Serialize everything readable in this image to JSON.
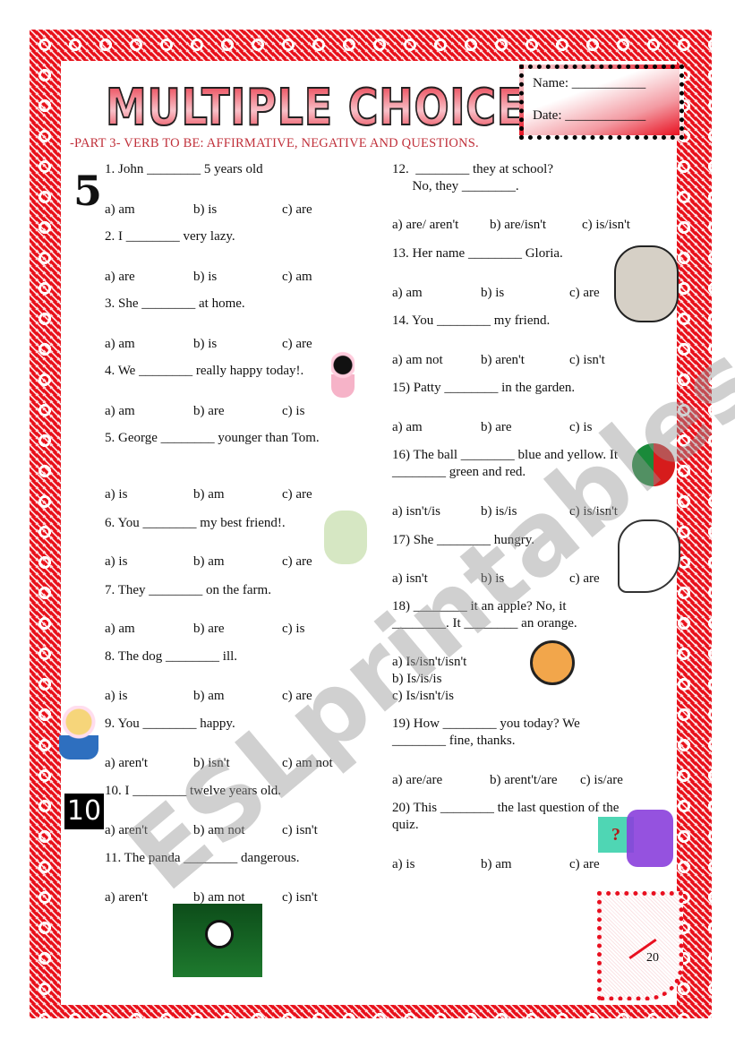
{
  "header": {
    "title": "MULTIPLE CHOICE",
    "subtitle": "-PART 3- VERB TO BE: AFFIRMATIVE, NEGATIVE AND QUESTIONS.",
    "name_label": "Name: ___________",
    "date_label": "Date: ____________"
  },
  "questions": [
    {
      "text": "1. John ________ 5 years old",
      "a": "a) am",
      "b": "b) is",
      "c": "c) are"
    },
    {
      "text": "2. I ________ very lazy.",
      "a": "a) are",
      "b": "b) is",
      "c": "c) am"
    },
    {
      "text": "3. She ________ at home.",
      "a": "a) am",
      "b": "b) is",
      "c": "c) are"
    },
    {
      "text": "4. We ________  really happy today!.",
      "a": "a) am",
      "b": "b) are",
      "c": "c) is"
    },
    {
      "text": "5. George ________ younger than Tom.",
      "a": "a) is",
      "b": "b) am",
      "c": "c) are"
    },
    {
      "text": "6. You ________ my best friend!.",
      "a": "a) is",
      "b": "b) am",
      "c": "c) are"
    },
    {
      "text": "7. They ________ on the farm.",
      "a": "a) am",
      "b": "b) are",
      "c": "c) is"
    },
    {
      "text": "8. The dog ________ ill.",
      "a": "a) is",
      "b": "b) am",
      "c": "c) are"
    },
    {
      "text": "9. You ________ happy.",
      "a": "a) aren't",
      "b": "b) isn't",
      "c": "c) am not"
    },
    {
      "text": "10. I ________  twelve years old.",
      "a": "a) aren't",
      "b": "b) am not",
      "c": "c) isn't"
    },
    {
      "text": "11. The panda ________ dangerous.",
      "a": "a) aren't",
      "b": "b) am not",
      "c": "c) isn't"
    },
    {
      "text": "12.  ________ they at school?\n      No, they ________.",
      "a": "a) are/ aren't",
      "b": "b) are/isn't",
      "c": "c) is/isn't"
    },
    {
      "text": "13. Her name  ________ Gloria.",
      "a": "a) am",
      "b": "b) is",
      "c": "c) are"
    },
    {
      "text": "14. You ________ my friend.",
      "a": "a) am not",
      "b": "b) aren't",
      "c": "c) isn't"
    },
    {
      "text": "15) Patty  ________  in the garden.",
      "a": "a) am",
      "b": "b) are",
      "c": "c) is"
    },
    {
      "text": "16) The ball ________  blue and yellow. It ________  green and red.",
      "a": "a) isn't/is",
      "b": "b) is/is",
      "c": "c) is/isn't"
    },
    {
      "text": "17) She ________  hungry.",
      "a": "a) isn't",
      "b": "b) is",
      "c": "c) are"
    },
    {
      "text": "18) ________ it an apple? No,  it ________. It ________ an orange.",
      "a": "a) Is/isn't/isn't",
      "b": "b) Is/is/is",
      "c": "c) Is/isn't/is"
    },
    {
      "text": "19) How ________  you today?  We ________  fine, thanks.",
      "a": "a) are/are",
      "b": "b) arent't/are",
      "c": "c) is/are"
    },
    {
      "text": "20) This ________  the last question of the quiz.",
      "a": "a) is",
      "b": "b) am",
      "c": "c) are"
    }
  ],
  "score": {
    "total": "20"
  },
  "watermark": "ESLprintables.com"
}
